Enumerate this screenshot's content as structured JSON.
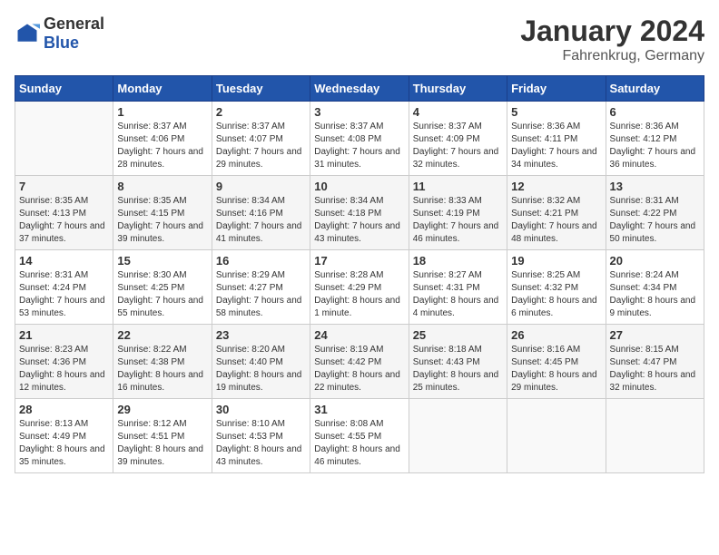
{
  "logo": {
    "general": "General",
    "blue": "Blue"
  },
  "header": {
    "month": "January 2024",
    "location": "Fahrenkrug, Germany"
  },
  "weekdays": [
    "Sunday",
    "Monday",
    "Tuesday",
    "Wednesday",
    "Thursday",
    "Friday",
    "Saturday"
  ],
  "weeks": [
    [
      {
        "day": "",
        "sunrise": "",
        "sunset": "",
        "daylight": ""
      },
      {
        "day": "1",
        "sunrise": "Sunrise: 8:37 AM",
        "sunset": "Sunset: 4:06 PM",
        "daylight": "Daylight: 7 hours and 28 minutes."
      },
      {
        "day": "2",
        "sunrise": "Sunrise: 8:37 AM",
        "sunset": "Sunset: 4:07 PM",
        "daylight": "Daylight: 7 hours and 29 minutes."
      },
      {
        "day": "3",
        "sunrise": "Sunrise: 8:37 AM",
        "sunset": "Sunset: 4:08 PM",
        "daylight": "Daylight: 7 hours and 31 minutes."
      },
      {
        "day": "4",
        "sunrise": "Sunrise: 8:37 AM",
        "sunset": "Sunset: 4:09 PM",
        "daylight": "Daylight: 7 hours and 32 minutes."
      },
      {
        "day": "5",
        "sunrise": "Sunrise: 8:36 AM",
        "sunset": "Sunset: 4:11 PM",
        "daylight": "Daylight: 7 hours and 34 minutes."
      },
      {
        "day": "6",
        "sunrise": "Sunrise: 8:36 AM",
        "sunset": "Sunset: 4:12 PM",
        "daylight": "Daylight: 7 hours and 36 minutes."
      }
    ],
    [
      {
        "day": "7",
        "sunrise": "Sunrise: 8:35 AM",
        "sunset": "Sunset: 4:13 PM",
        "daylight": "Daylight: 7 hours and 37 minutes."
      },
      {
        "day": "8",
        "sunrise": "Sunrise: 8:35 AM",
        "sunset": "Sunset: 4:15 PM",
        "daylight": "Daylight: 7 hours and 39 minutes."
      },
      {
        "day": "9",
        "sunrise": "Sunrise: 8:34 AM",
        "sunset": "Sunset: 4:16 PM",
        "daylight": "Daylight: 7 hours and 41 minutes."
      },
      {
        "day": "10",
        "sunrise": "Sunrise: 8:34 AM",
        "sunset": "Sunset: 4:18 PM",
        "daylight": "Daylight: 7 hours and 43 minutes."
      },
      {
        "day": "11",
        "sunrise": "Sunrise: 8:33 AM",
        "sunset": "Sunset: 4:19 PM",
        "daylight": "Daylight: 7 hours and 46 minutes."
      },
      {
        "day": "12",
        "sunrise": "Sunrise: 8:32 AM",
        "sunset": "Sunset: 4:21 PM",
        "daylight": "Daylight: 7 hours and 48 minutes."
      },
      {
        "day": "13",
        "sunrise": "Sunrise: 8:31 AM",
        "sunset": "Sunset: 4:22 PM",
        "daylight": "Daylight: 7 hours and 50 minutes."
      }
    ],
    [
      {
        "day": "14",
        "sunrise": "Sunrise: 8:31 AM",
        "sunset": "Sunset: 4:24 PM",
        "daylight": "Daylight: 7 hours and 53 minutes."
      },
      {
        "day": "15",
        "sunrise": "Sunrise: 8:30 AM",
        "sunset": "Sunset: 4:25 PM",
        "daylight": "Daylight: 7 hours and 55 minutes."
      },
      {
        "day": "16",
        "sunrise": "Sunrise: 8:29 AM",
        "sunset": "Sunset: 4:27 PM",
        "daylight": "Daylight: 7 hours and 58 minutes."
      },
      {
        "day": "17",
        "sunrise": "Sunrise: 8:28 AM",
        "sunset": "Sunset: 4:29 PM",
        "daylight": "Daylight: 8 hours and 1 minute."
      },
      {
        "day": "18",
        "sunrise": "Sunrise: 8:27 AM",
        "sunset": "Sunset: 4:31 PM",
        "daylight": "Daylight: 8 hours and 4 minutes."
      },
      {
        "day": "19",
        "sunrise": "Sunrise: 8:25 AM",
        "sunset": "Sunset: 4:32 PM",
        "daylight": "Daylight: 8 hours and 6 minutes."
      },
      {
        "day": "20",
        "sunrise": "Sunrise: 8:24 AM",
        "sunset": "Sunset: 4:34 PM",
        "daylight": "Daylight: 8 hours and 9 minutes."
      }
    ],
    [
      {
        "day": "21",
        "sunrise": "Sunrise: 8:23 AM",
        "sunset": "Sunset: 4:36 PM",
        "daylight": "Daylight: 8 hours and 12 minutes."
      },
      {
        "day": "22",
        "sunrise": "Sunrise: 8:22 AM",
        "sunset": "Sunset: 4:38 PM",
        "daylight": "Daylight: 8 hours and 16 minutes."
      },
      {
        "day": "23",
        "sunrise": "Sunrise: 8:20 AM",
        "sunset": "Sunset: 4:40 PM",
        "daylight": "Daylight: 8 hours and 19 minutes."
      },
      {
        "day": "24",
        "sunrise": "Sunrise: 8:19 AM",
        "sunset": "Sunset: 4:42 PM",
        "daylight": "Daylight: 8 hours and 22 minutes."
      },
      {
        "day": "25",
        "sunrise": "Sunrise: 8:18 AM",
        "sunset": "Sunset: 4:43 PM",
        "daylight": "Daylight: 8 hours and 25 minutes."
      },
      {
        "day": "26",
        "sunrise": "Sunrise: 8:16 AM",
        "sunset": "Sunset: 4:45 PM",
        "daylight": "Daylight: 8 hours and 29 minutes."
      },
      {
        "day": "27",
        "sunrise": "Sunrise: 8:15 AM",
        "sunset": "Sunset: 4:47 PM",
        "daylight": "Daylight: 8 hours and 32 minutes."
      }
    ],
    [
      {
        "day": "28",
        "sunrise": "Sunrise: 8:13 AM",
        "sunset": "Sunset: 4:49 PM",
        "daylight": "Daylight: 8 hours and 35 minutes."
      },
      {
        "day": "29",
        "sunrise": "Sunrise: 8:12 AM",
        "sunset": "Sunset: 4:51 PM",
        "daylight": "Daylight: 8 hours and 39 minutes."
      },
      {
        "day": "30",
        "sunrise": "Sunrise: 8:10 AM",
        "sunset": "Sunset: 4:53 PM",
        "daylight": "Daylight: 8 hours and 43 minutes."
      },
      {
        "day": "31",
        "sunrise": "Sunrise: 8:08 AM",
        "sunset": "Sunset: 4:55 PM",
        "daylight": "Daylight: 8 hours and 46 minutes."
      },
      {
        "day": "",
        "sunrise": "",
        "sunset": "",
        "daylight": ""
      },
      {
        "day": "",
        "sunrise": "",
        "sunset": "",
        "daylight": ""
      },
      {
        "day": "",
        "sunrise": "",
        "sunset": "",
        "daylight": ""
      }
    ]
  ]
}
